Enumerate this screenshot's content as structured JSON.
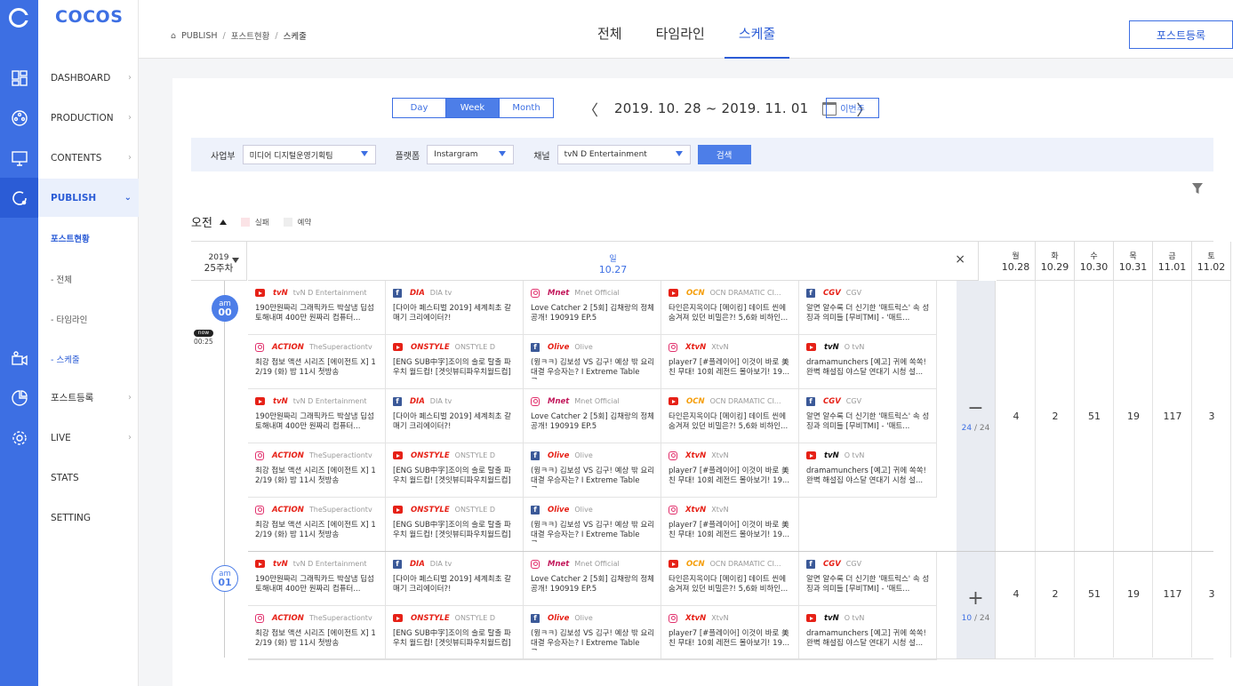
{
  "brand": "COCOS",
  "menu": {
    "items": [
      {
        "label": "DASHBOARD"
      },
      {
        "label": "PRODUCTION"
      },
      {
        "label": "CONTENTS"
      },
      {
        "label": "PUBLISH"
      },
      {
        "label": "포스트현황"
      },
      {
        "label": "- 전체"
      },
      {
        "label": "- 타임라인"
      },
      {
        "label": "- 스케줄"
      },
      {
        "label": "포스트등록"
      },
      {
        "label": "LIVE"
      },
      {
        "label": "STATS"
      },
      {
        "label": "SETTING"
      }
    ]
  },
  "breadcrumb": {
    "home": "PUBLISH",
    "mid": "포스트현황",
    "cur": "스케줄",
    "sep": "/"
  },
  "tabs": [
    "전체",
    "타임라인",
    "스케줄"
  ],
  "post_button": "포스트등록",
  "view": {
    "day": "Day",
    "week": "Week",
    "month": "Month",
    "prev": "〈",
    "next": "〉",
    "range": "2019. 10. 28 ~ 2019. 11. 01",
    "this_week": "이번주"
  },
  "filters": {
    "dept_label": "사업부",
    "dept": "미디어 디지털운영기획팀",
    "platform_label": "플랫폼",
    "platform": "Instargram",
    "channel_label": "채널",
    "channel": "tvN D Entertainment",
    "search": "검색"
  },
  "section": {
    "title": "오전",
    "legend_fail": "실패",
    "legend_reserve": "예약",
    "colors": {
      "fail": "#fbe3e6",
      "reserve": "#eeeeee"
    }
  },
  "header": {
    "year": "2019",
    "week": "25주차",
    "sun_label": "일",
    "sun_date": "10.27",
    "close": "×",
    "days": [
      {
        "d": "월",
        "n": "10.28"
      },
      {
        "d": "화",
        "n": "10.29"
      },
      {
        "d": "수",
        "n": "10.30"
      },
      {
        "d": "목",
        "n": "10.31"
      },
      {
        "d": "금",
        "n": "11.01"
      },
      {
        "d": "토",
        "n": "11.02"
      }
    ]
  },
  "hours": [
    {
      "ap": "am",
      "h": "00"
    },
    {
      "ap": "am",
      "h": "01"
    }
  ],
  "now": {
    "badge": "now",
    "time": "00:25"
  },
  "cards": {
    "A": [
      {
        "p": "yt",
        "logo": "tvN",
        "lc": "#e62117",
        "ch": "tvN D Entertainment",
        "t": "190만원짜리 그래픽카드 박살냄 딥섬 토해내며 400만 원짜리 컴퓨터..."
      },
      {
        "p": "fb",
        "logo": "DIA",
        "lc": "#e62117",
        "ch": "DIA tv",
        "t": "[다이아 페스티벌 2019] 세계최초 갈매기 크리에이터?!"
      },
      {
        "p": "ig",
        "logo": "Mnet",
        "lc": "#c2185b",
        "ch": "Mnet Official",
        "t": "Love Catcher 2 [5회] 김채랑의 정체 공개! 190919 EP.5"
      },
      {
        "p": "yt",
        "logo": "OCN",
        "lc": "#f59e0b",
        "ch": "OCN DRAMATIC CI...",
        "t": "타인은지옥이다 [메이킹] 데이트 씬에 숨겨져 있던 비밀은?! 5,6화 비하인..."
      },
      {
        "p": "fb",
        "logo": "CGV",
        "lc": "#e62117",
        "ch": "CGV",
        "t": "알면 알수록 더 신기한 '매트릭스' 속 성징과 의미들 [무비TMI] - '매트..."
      }
    ],
    "B": [
      {
        "p": "ig",
        "logo": "ACTION",
        "lc": "#e62117",
        "ch": "TheSuperactiontv",
        "t": "최강 첩보 액션 시리즈 [에이전트 X] 12/19 (화) 밤 11시 첫방송"
      },
      {
        "p": "yt",
        "logo": "ONSTYLE",
        "lc": "#e62117",
        "ch": "ONSTYLE D",
        "t": "[ENG SUB中字]조이의 솔로 탈출 파우치 월드컵! [겟잇뷰티파우치월드컵]"
      },
      {
        "p": "fb",
        "logo": "Olive",
        "lc": "#e62117",
        "ch": "Olive",
        "t": "(윙ㅋㅋ) 김보성 VS 김구! 예상 밖 요리 대결 우승자는? I Extreme Table 극..."
      },
      {
        "p": "ig",
        "logo": "XtvN",
        "lc": "#e62117",
        "ch": "XtvN",
        "t": "player7 [#플레이어] 이것이 바로 美친 무대! 10회 레전드 몰아보기! 19..."
      },
      {
        "p": "yt",
        "logo": "tvN",
        "lc": "#111111",
        "ch": "O tvN",
        "t": "dramamunchers [예고] 귀에 쏙쏙! 완벽 해설집 야스달 연대기 시청 설..."
      }
    ],
    "C": [
      {
        "p": "ig",
        "logo": "ACTION",
        "lc": "#e62117",
        "ch": "TheSuperactiontv",
        "t": "최강 첩보 액션 시리즈 [에이전트 X] 12/19 (화) 밤 11시 첫방송"
      },
      {
        "p": "yt",
        "logo": "ONSTYLE",
        "lc": "#e62117",
        "ch": "ONSTYLE D",
        "t": "[ENG SUB中字]조이의 솔로 탈출 파우치 월드컵! [겟잇뷰티파우치월드컵]"
      },
      {
        "p": "fb",
        "logo": "Olive",
        "lc": "#e62117",
        "ch": "Olive",
        "t": "(윙ㅋㅋ) 김보성 VS 김구! 예상 밖 요리 대결 우승자는? I Extreme Table 극..."
      },
      {
        "p": "ig",
        "logo": "XtvN",
        "lc": "#e62117",
        "ch": "XtvN",
        "t": "player7 [#플레이어] 이것이 바로 美친 무대! 10회 레전드 몰아보기! 19..."
      }
    ]
  },
  "hour0": {
    "sym": "−",
    "shown": "24",
    "total": "24",
    "sep": "/",
    "counts": [
      "4",
      "2",
      "51",
      "19",
      "117",
      "3"
    ]
  },
  "hour1": {
    "sym": "+",
    "shown": "10",
    "total": "24",
    "sep": "/",
    "counts": [
      "4",
      "2",
      "51",
      "19",
      "117",
      "3"
    ]
  },
  "colors": {
    "accent": "#3d6fe3",
    "sidebar": "#3d6fe3"
  }
}
